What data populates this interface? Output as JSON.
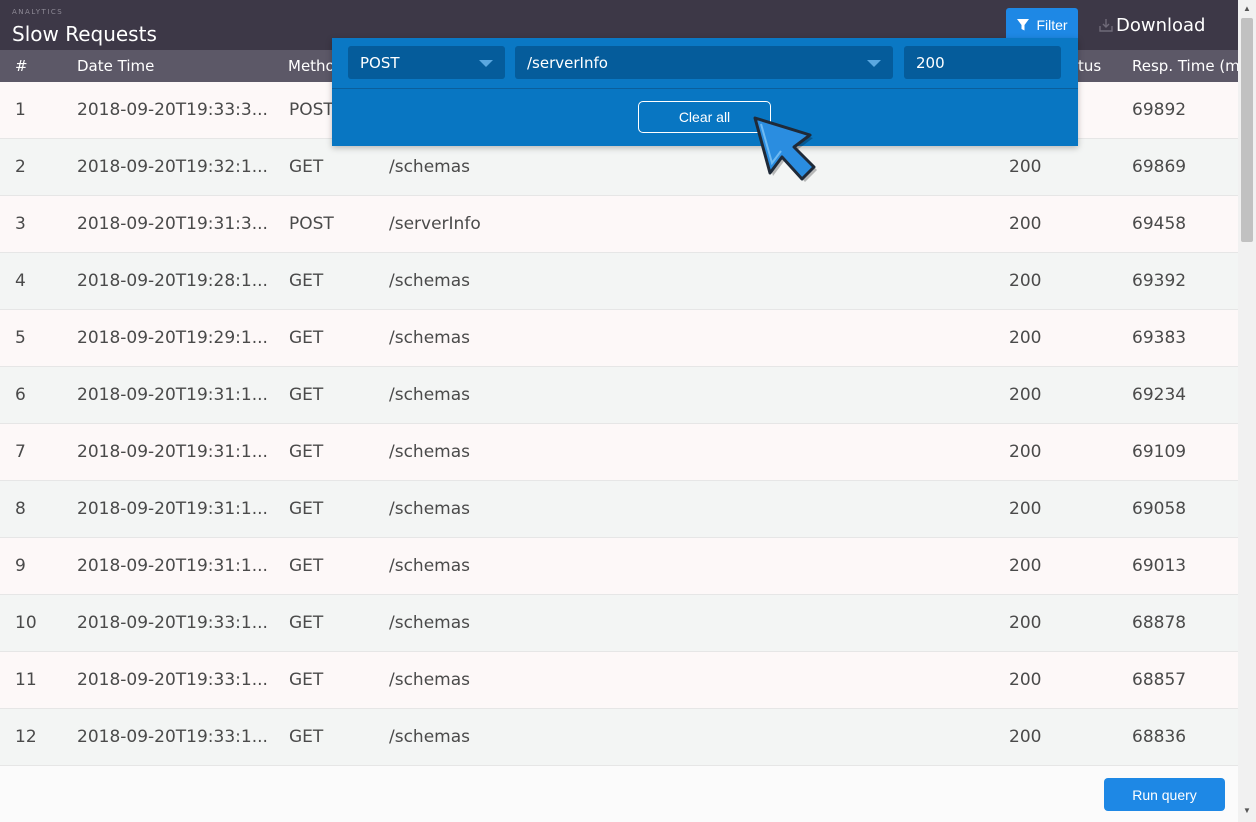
{
  "header": {
    "section_label": "ANALYTICS",
    "title": "Slow Requests",
    "filter_label": "Filter",
    "download_label": "Download"
  },
  "columns": {
    "num": "#",
    "date_time": "Date Time",
    "method": "Metho",
    "status": "tus",
    "resp_time": "Resp. Time (ms"
  },
  "rows": [
    {
      "num": "1",
      "date": "2018-09-20T19:33:3...",
      "method": "POST",
      "path": "",
      "status": "",
      "time": "69892"
    },
    {
      "num": "2",
      "date": "2018-09-20T19:32:1...",
      "method": "GET",
      "path": "/schemas",
      "status": "200",
      "time": "69869"
    },
    {
      "num": "3",
      "date": "2018-09-20T19:31:3...",
      "method": "POST",
      "path": "/serverInfo",
      "status": "200",
      "time": "69458"
    },
    {
      "num": "4",
      "date": "2018-09-20T19:28:1...",
      "method": "GET",
      "path": "/schemas",
      "status": "200",
      "time": "69392"
    },
    {
      "num": "5",
      "date": "2018-09-20T19:29:1...",
      "method": "GET",
      "path": "/schemas",
      "status": "200",
      "time": "69383"
    },
    {
      "num": "6",
      "date": "2018-09-20T19:31:1...",
      "method": "GET",
      "path": "/schemas",
      "status": "200",
      "time": "69234"
    },
    {
      "num": "7",
      "date": "2018-09-20T19:31:1...",
      "method": "GET",
      "path": "/schemas",
      "status": "200",
      "time": "69109"
    },
    {
      "num": "8",
      "date": "2018-09-20T19:31:1...",
      "method": "GET",
      "path": "/schemas",
      "status": "200",
      "time": "69058"
    },
    {
      "num": "9",
      "date": "2018-09-20T19:31:1...",
      "method": "GET",
      "path": "/schemas",
      "status": "200",
      "time": "69013"
    },
    {
      "num": "10",
      "date": "2018-09-20T19:33:1...",
      "method": "GET",
      "path": "/schemas",
      "status": "200",
      "time": "68878"
    },
    {
      "num": "11",
      "date": "2018-09-20T19:33:1...",
      "method": "GET",
      "path": "/schemas",
      "status": "200",
      "time": "68857"
    },
    {
      "num": "12",
      "date": "2018-09-20T19:33:1...",
      "method": "GET",
      "path": "/schemas",
      "status": "200",
      "time": "68836"
    }
  ],
  "filter_panel": {
    "method_value": "POST",
    "path_value": "/serverInfo",
    "status_value": "200",
    "clear_all_label": "Clear all"
  },
  "footer": {
    "run_query_label": "Run query"
  },
  "colors": {
    "header_bg": "#3d3847",
    "column_header_bg": "#5c5867",
    "accent": "#1e88e5",
    "filter_panel_bg": "#0a78c4"
  }
}
